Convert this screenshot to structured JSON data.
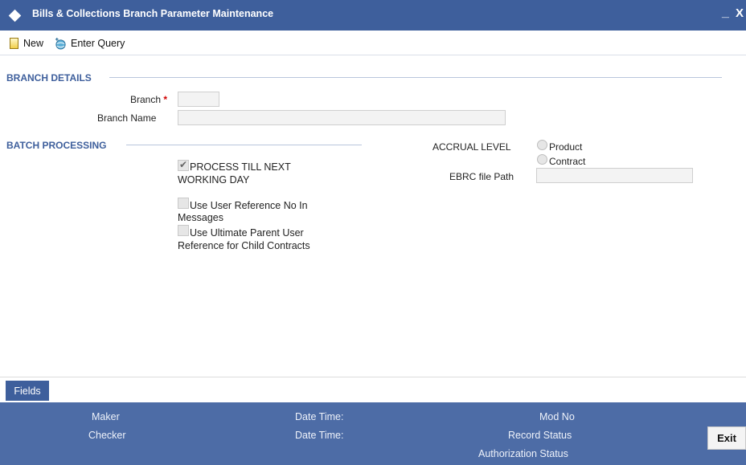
{
  "window": {
    "title": "Bills & Collections Branch Parameter Maintenance",
    "minimize_glyph": "_",
    "close_glyph": "X"
  },
  "toolbar": {
    "new_label": "New",
    "enter_query_label": "Enter Query"
  },
  "branch_details": {
    "section_title": "BRANCH DETAILS",
    "branch_label": "Branch",
    "required_marker": "*",
    "branch_value": "",
    "branch_name_label": "Branch Name",
    "branch_name_value": ""
  },
  "batch_processing": {
    "section_title": "BATCH PROCESSING",
    "process_till_next_working_day": {
      "line1": "PROCESS TILL NEXT",
      "line2": "WORKING DAY",
      "checked": true
    },
    "use_user_reference": {
      "line1": "Use User Reference No In",
      "line2": "Messages",
      "checked": false
    },
    "use_ultimate_parent": {
      "line1": "Use Ultimate Parent User",
      "line2": "Reference for Child Contracts",
      "checked": false
    },
    "accrual_level_label": "ACCRUAL LEVEL",
    "accrual_options": [
      "Product",
      "Contract"
    ],
    "ebrc_label": "EBRC file Path",
    "ebrc_value": ""
  },
  "fields_tab_label": "Fields",
  "footer": {
    "maker_label": "Maker",
    "checker_label": "Checker",
    "date_time_label": "Date Time:",
    "mod_no_label": "Mod No",
    "record_status_label": "Record Status",
    "authorization_status_label": "Authorization Status",
    "exit_label": "Exit"
  },
  "colors": {
    "title_bar": "#3e5f9c",
    "footer_bar": "#4d6ca6",
    "section_title": "#3e5f9c",
    "required_marker": "#d00000"
  },
  "icons": {
    "title": "diamond-icon",
    "new": "new-document-icon",
    "enter_query": "query-globe-icon"
  }
}
